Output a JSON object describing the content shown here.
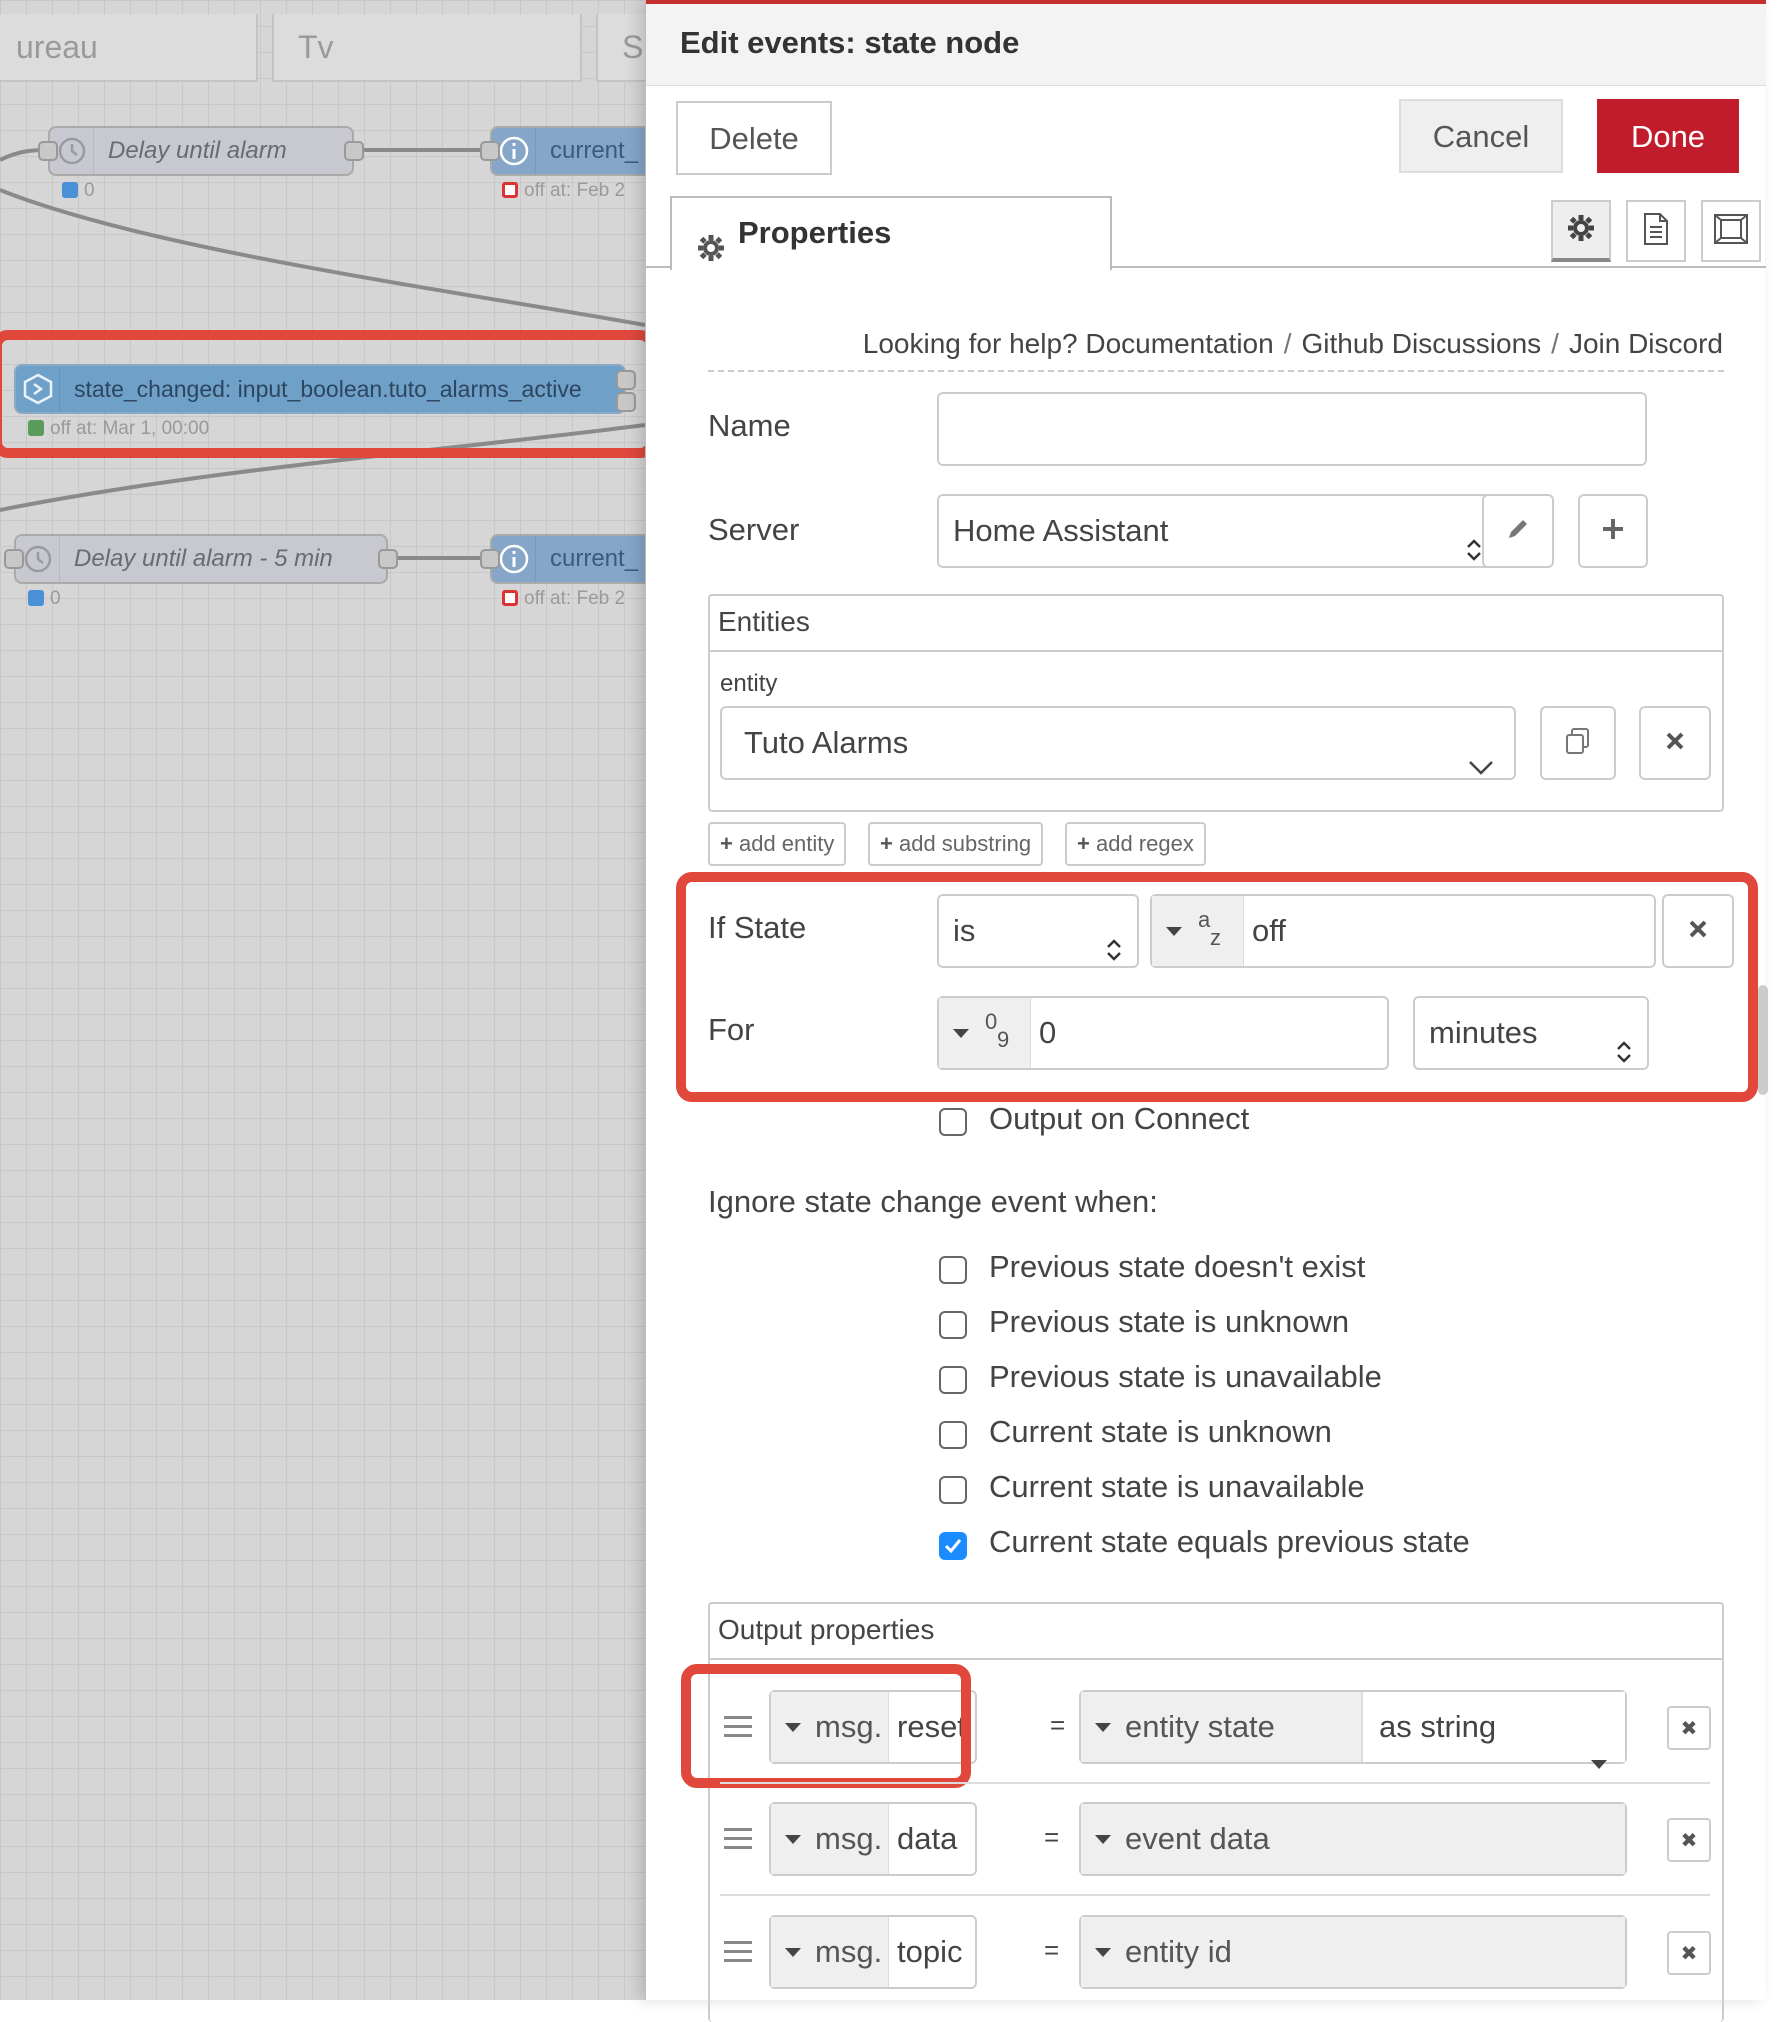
{
  "canvas": {
    "tabs": [
      "ureau",
      "Tv",
      "S"
    ],
    "nodes": {
      "delay1": {
        "label": "Delay until alarm",
        "status": "0"
      },
      "current1": {
        "label": "current_",
        "status": "off at: Feb 2"
      },
      "state_changed": {
        "label": "state_changed: input_boolean.tuto_alarms_active",
        "status": "off at: Mar 1, 00:00"
      },
      "delay2": {
        "label": "Delay until alarm - 5 min",
        "status": "0"
      },
      "current2": {
        "label": "current_",
        "status": "off at: Feb 2"
      }
    }
  },
  "panel": {
    "title": "Edit events: state node",
    "delete_label": "Delete",
    "cancel_label": "Cancel",
    "done_label": "Done",
    "properties_tab": "Properties",
    "help": {
      "prefix": "Looking for help?",
      "links": [
        "Documentation",
        "Github Discussions",
        "Join Discord"
      ]
    },
    "name_label": "Name",
    "name_value": "",
    "server_label": "Server",
    "server_value": "Home Assistant",
    "entities": {
      "title": "Entities",
      "entity_label": "entity",
      "entity_value": "Tuto Alarms",
      "add_entity": "add entity",
      "add_substring": "add substring",
      "add_regex": "add regex"
    },
    "if_state": {
      "label": "If State",
      "operator": "is",
      "type_glyph_top": "a",
      "type_glyph_bottom": "z",
      "value": "off"
    },
    "for": {
      "label": "For",
      "type_glyph_top": "0",
      "type_glyph_bottom": "9",
      "value": "0",
      "unit": "minutes"
    },
    "output_on_connect": "Output on Connect",
    "ignore": {
      "title": "Ignore state change event when:",
      "options": [
        {
          "label": "Previous state doesn't exist",
          "checked": false
        },
        {
          "label": "Previous state is unknown",
          "checked": false
        },
        {
          "label": "Previous state is unavailable",
          "checked": false
        },
        {
          "label": "Current state is unknown",
          "checked": false
        },
        {
          "label": "Current state is unavailable",
          "checked": false
        },
        {
          "label": "Current state equals previous state",
          "checked": true
        }
      ]
    },
    "output_properties": {
      "title": "Output properties",
      "rows": [
        {
          "prefix": "msg.",
          "property": "reset",
          "eq": "=",
          "value": "entity state",
          "extra": "as string"
        },
        {
          "prefix": "msg.",
          "property": "data",
          "eq": "=",
          "value": "event data"
        },
        {
          "prefix": "msg.",
          "property": "topic",
          "eq": "=",
          "value": "entity id"
        }
      ]
    }
  },
  "colors": {
    "accent": "#c11c2b",
    "callout": "#e0483c",
    "checkbox_on": "#1a8cff"
  }
}
